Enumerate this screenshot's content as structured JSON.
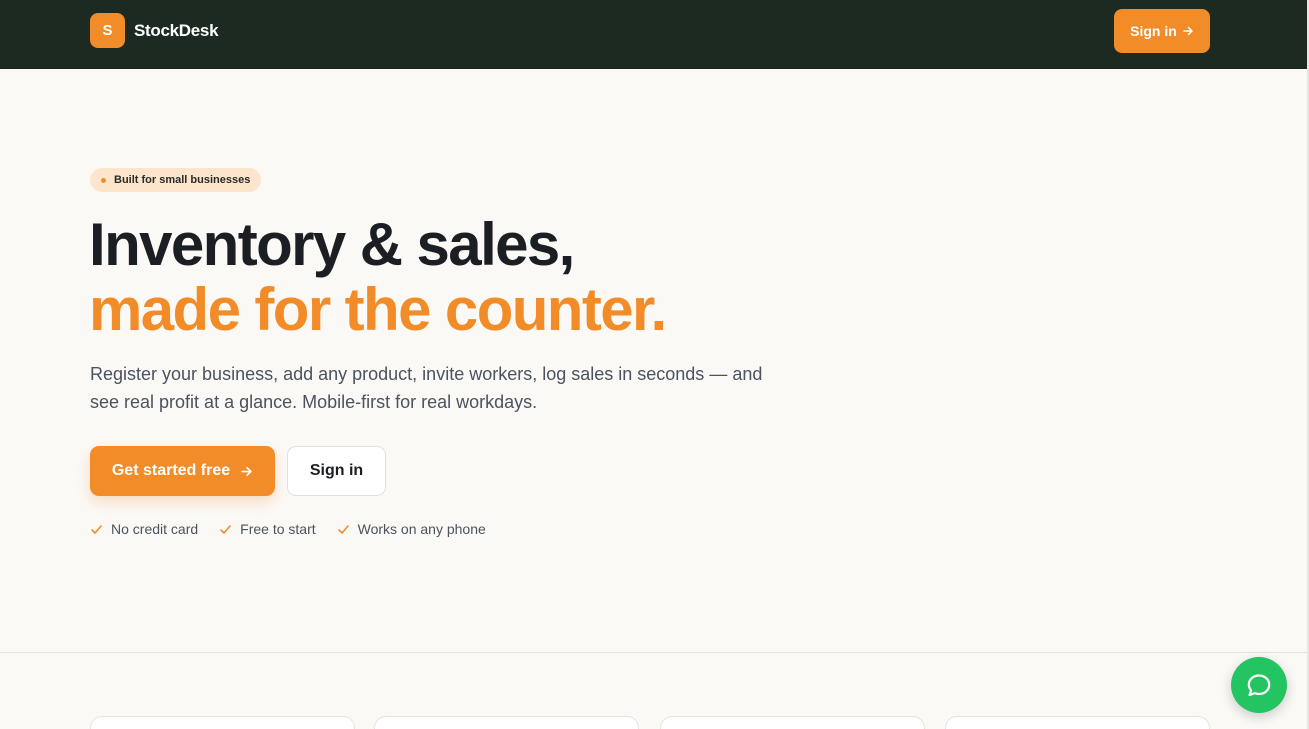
{
  "header": {
    "logo_letter": "S",
    "brand": "StockDesk",
    "signin_label": "Sign in",
    "signin_icon": "arrow-right-icon"
  },
  "hero": {
    "badge": "Built for small businesses",
    "title_line1": "Inventory & sales,",
    "title_line2": "made for the counter.",
    "subtitle": "Register your business, add any product, invite workers, log sales in seconds — and see real profit at a glance. Mobile-first for real workdays.",
    "primary_cta": "Get started free",
    "secondary_cta": "Sign in",
    "perks": [
      "No credit card",
      "Free to start",
      "Works on any phone"
    ]
  },
  "chat": {
    "icon": "chat-bubble-icon"
  },
  "colors": {
    "accent": "#f28c28",
    "topbar": "#1c2a22",
    "chat": "#25c462",
    "background": "#fbf9f6"
  }
}
